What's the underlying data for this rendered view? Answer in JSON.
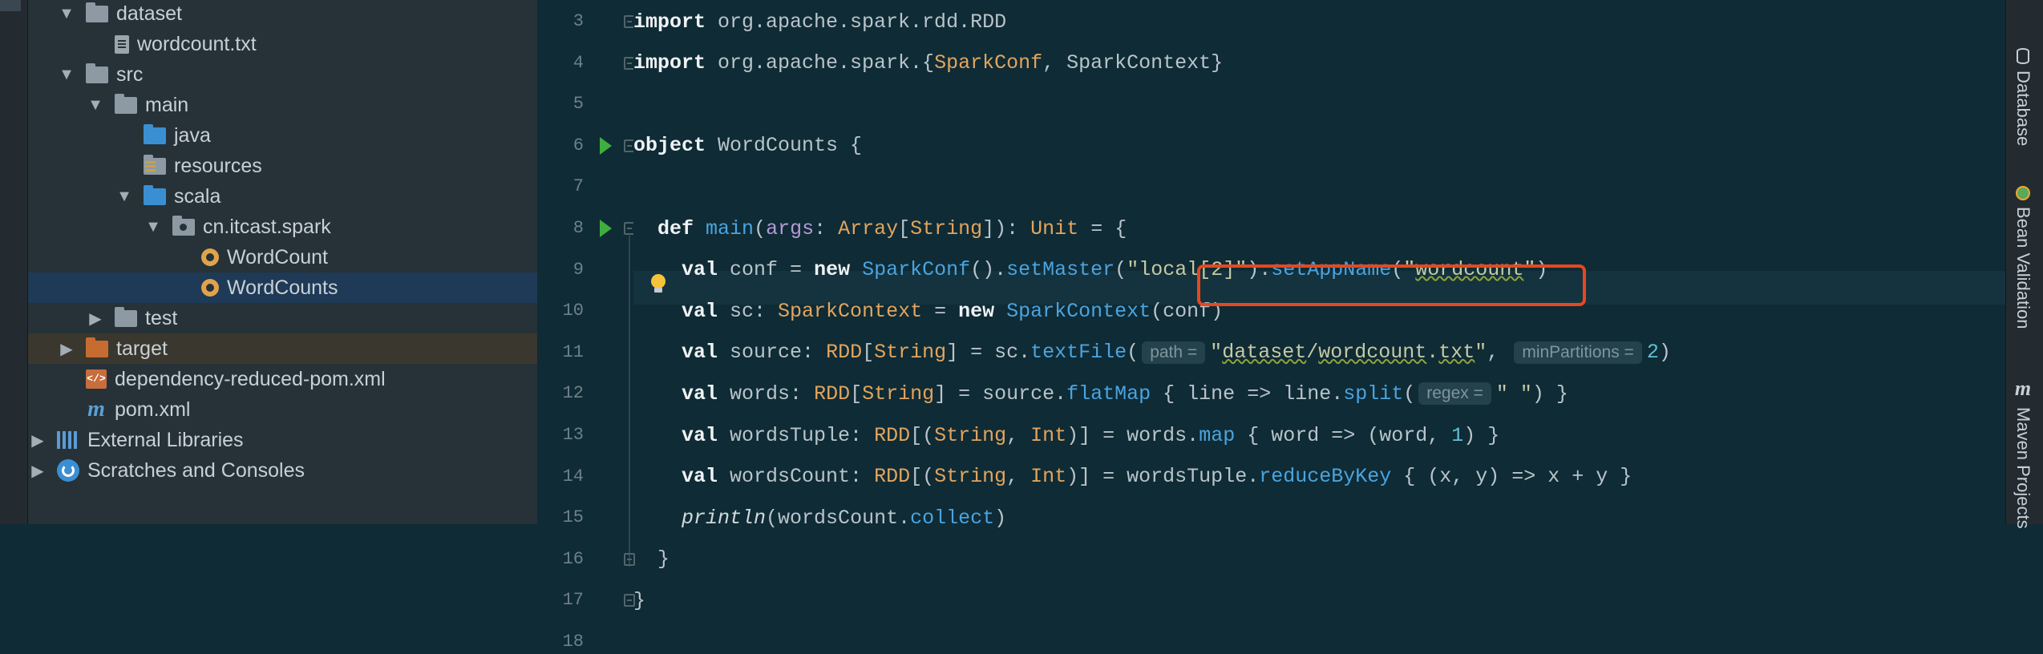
{
  "project_tree": [
    {
      "label": "dataset",
      "icon": "folder-icon",
      "depth": 1,
      "arrow": "expanded"
    },
    {
      "label": "wordcount.txt",
      "icon": "text-file-icon",
      "depth": 3,
      "arrow": "none"
    },
    {
      "label": "src",
      "icon": "folder-icon",
      "depth": 1,
      "arrow": "expanded"
    },
    {
      "label": "main",
      "icon": "folder-icon",
      "depth": 2,
      "arrow": "expanded"
    },
    {
      "label": "java",
      "icon": "source-folder-icon",
      "depth": 4,
      "arrow": "none"
    },
    {
      "label": "resources",
      "icon": "resources-folder-icon",
      "depth": 4,
      "arrow": "none"
    },
    {
      "label": "scala",
      "icon": "source-folder-icon",
      "depth": 3,
      "arrow": "expanded"
    },
    {
      "label": "cn.itcast.spark",
      "icon": "package-icon",
      "depth": 4,
      "arrow": "expanded"
    },
    {
      "label": "WordCount",
      "icon": "scala-object-icon",
      "depth": 6,
      "arrow": "none"
    },
    {
      "label": "WordCounts",
      "icon": "scala-object-icon",
      "depth": 6,
      "arrow": "none",
      "selected": true
    },
    {
      "label": "test",
      "icon": "folder-icon",
      "depth": 2,
      "arrow": "collapsed"
    },
    {
      "label": "target",
      "icon": "excluded-folder-icon",
      "depth": 1,
      "arrow": "collapsed",
      "excluded": true
    },
    {
      "label": "dependency-reduced-pom.xml",
      "icon": "xml-file-icon",
      "depth": 2,
      "arrow": "none"
    },
    {
      "label": "pom.xml",
      "icon": "maven-file-icon",
      "depth": 2,
      "arrow": "none"
    },
    {
      "label": "External Libraries",
      "icon": "libraries-icon",
      "depth": 0,
      "arrow": "collapsed"
    },
    {
      "label": "Scratches and Consoles",
      "icon": "scratches-icon",
      "depth": 0,
      "arrow": "collapsed"
    }
  ],
  "editor": {
    "line_numbers": [
      "3",
      "4",
      "5",
      "6",
      "7",
      "8",
      "9",
      "10",
      "11",
      "12",
      "13",
      "14",
      "15",
      "16",
      "17",
      "18"
    ],
    "hints": {
      "path": "path =",
      "min_partitions": "minPartitions =",
      "regex": "regex ="
    },
    "lines": [
      [
        [
          "kw",
          "import"
        ],
        [
          "p",
          " org.apache.spark.rdd.RDD"
        ]
      ],
      [
        [
          "kw",
          "import"
        ],
        [
          "p",
          " org.apache.spark.{"
        ],
        [
          "ty",
          "SparkConf"
        ],
        [
          "p",
          ", SparkContext}"
        ]
      ],
      [],
      [
        [
          "kw",
          "object"
        ],
        [
          "p",
          " WordCounts {"
        ]
      ],
      [],
      [
        [
          "p",
          "  "
        ],
        [
          "kw",
          "def"
        ],
        [
          "p",
          " "
        ],
        [
          "fn",
          "main"
        ],
        [
          "p",
          "("
        ],
        [
          "ar",
          "args"
        ],
        [
          "p",
          ": "
        ],
        [
          "ty",
          "Array"
        ],
        [
          "p",
          "["
        ],
        [
          "ty",
          "String"
        ],
        [
          "p",
          "]): "
        ],
        [
          "ty",
          "Unit"
        ],
        [
          "p",
          " = {"
        ]
      ],
      [
        [
          "p",
          "    "
        ],
        [
          "kw",
          "val"
        ],
        [
          "p",
          " conf = "
        ],
        [
          "kw",
          "new"
        ],
        [
          "p",
          " "
        ],
        [
          "fn",
          "SparkConf"
        ],
        [
          "p",
          "()."
        ],
        [
          "fn",
          "setMaster"
        ],
        [
          "p",
          "("
        ],
        [
          "st",
          "\"local[2]\""
        ],
        [
          "p",
          ")."
        ],
        [
          "fn",
          "setAppName"
        ],
        [
          "p",
          "("
        ],
        [
          "st",
          "\""
        ],
        [
          "sq",
          "wordcount"
        ],
        [
          "st",
          "\""
        ],
        [
          "p",
          ")"
        ]
      ],
      [
        [
          "p",
          "    "
        ],
        [
          "kw",
          "val"
        ],
        [
          "p",
          " sc: "
        ],
        [
          "ty",
          "SparkContext"
        ],
        [
          "p",
          " = "
        ],
        [
          "kw",
          "new"
        ],
        [
          "p",
          " "
        ],
        [
          "fn",
          "SparkContext"
        ],
        [
          "p",
          "(conf)"
        ]
      ],
      [
        [
          "p",
          "    "
        ],
        [
          "kw",
          "val"
        ],
        [
          "p",
          " source: "
        ],
        [
          "ty",
          "RDD"
        ],
        [
          "p",
          "["
        ],
        [
          "ty",
          "String"
        ],
        [
          "p",
          "] = sc."
        ],
        [
          "fn",
          "textFile"
        ],
        [
          "p",
          "("
        ],
        [
          "hint",
          "path"
        ],
        [
          "st",
          "\""
        ],
        [
          "sq",
          "dataset"
        ],
        [
          "st",
          "/"
        ],
        [
          "sq",
          "wordcount"
        ],
        [
          "st",
          "."
        ],
        [
          "sq",
          "txt"
        ],
        [
          "st",
          "\""
        ],
        [
          "p",
          ", "
        ],
        [
          "hint",
          "min_partitions"
        ],
        [
          "nu",
          "2"
        ],
        [
          "p",
          ")"
        ]
      ],
      [
        [
          "p",
          "    "
        ],
        [
          "kw",
          "val"
        ],
        [
          "p",
          " words: "
        ],
        [
          "ty",
          "RDD"
        ],
        [
          "p",
          "["
        ],
        [
          "ty",
          "String"
        ],
        [
          "p",
          "] = source."
        ],
        [
          "fn",
          "flatMap"
        ],
        [
          "p",
          " { line => line."
        ],
        [
          "fn",
          "split"
        ],
        [
          "p",
          "("
        ],
        [
          "hint",
          "regex"
        ],
        [
          "st",
          "\" \""
        ],
        [
          "p",
          ") }"
        ]
      ],
      [
        [
          "p",
          "    "
        ],
        [
          "kw",
          "val"
        ],
        [
          "p",
          " wordsTuple: "
        ],
        [
          "ty",
          "RDD"
        ],
        [
          "p",
          "[("
        ],
        [
          "ty",
          "String"
        ],
        [
          "p",
          ", "
        ],
        [
          "ty",
          "Int"
        ],
        [
          "p",
          ")] = words."
        ],
        [
          "fn",
          "map"
        ],
        [
          "p",
          " { word => (word, "
        ],
        [
          "nu",
          "1"
        ],
        [
          "p",
          ") }"
        ]
      ],
      [
        [
          "p",
          "    "
        ],
        [
          "kw",
          "val"
        ],
        [
          "p",
          " wordsCount: "
        ],
        [
          "ty",
          "RDD"
        ],
        [
          "p",
          "[("
        ],
        [
          "ty",
          "String"
        ],
        [
          "p",
          ", "
        ],
        [
          "ty",
          "Int"
        ],
        [
          "p",
          ")] = wordsTuple."
        ],
        [
          "fn",
          "reduceByKey"
        ],
        [
          "p",
          " { (x, y) => x + y }"
        ]
      ],
      [
        [
          "p",
          "    "
        ],
        [
          "it",
          "println"
        ],
        [
          "p",
          "(wordsCount."
        ],
        [
          "fn",
          "collect"
        ],
        [
          "p",
          ")"
        ]
      ],
      [
        [
          "p",
          "  }"
        ]
      ],
      [
        [
          "p",
          "}"
        ]
      ],
      []
    ]
  },
  "right_tool_windows": [
    "Database",
    "Bean Validation",
    "Maven Projects"
  ],
  "colors": {
    "highlight_box": "#e8471f",
    "editor_background": "#0f2b35",
    "sidebar_background": "#263238"
  }
}
